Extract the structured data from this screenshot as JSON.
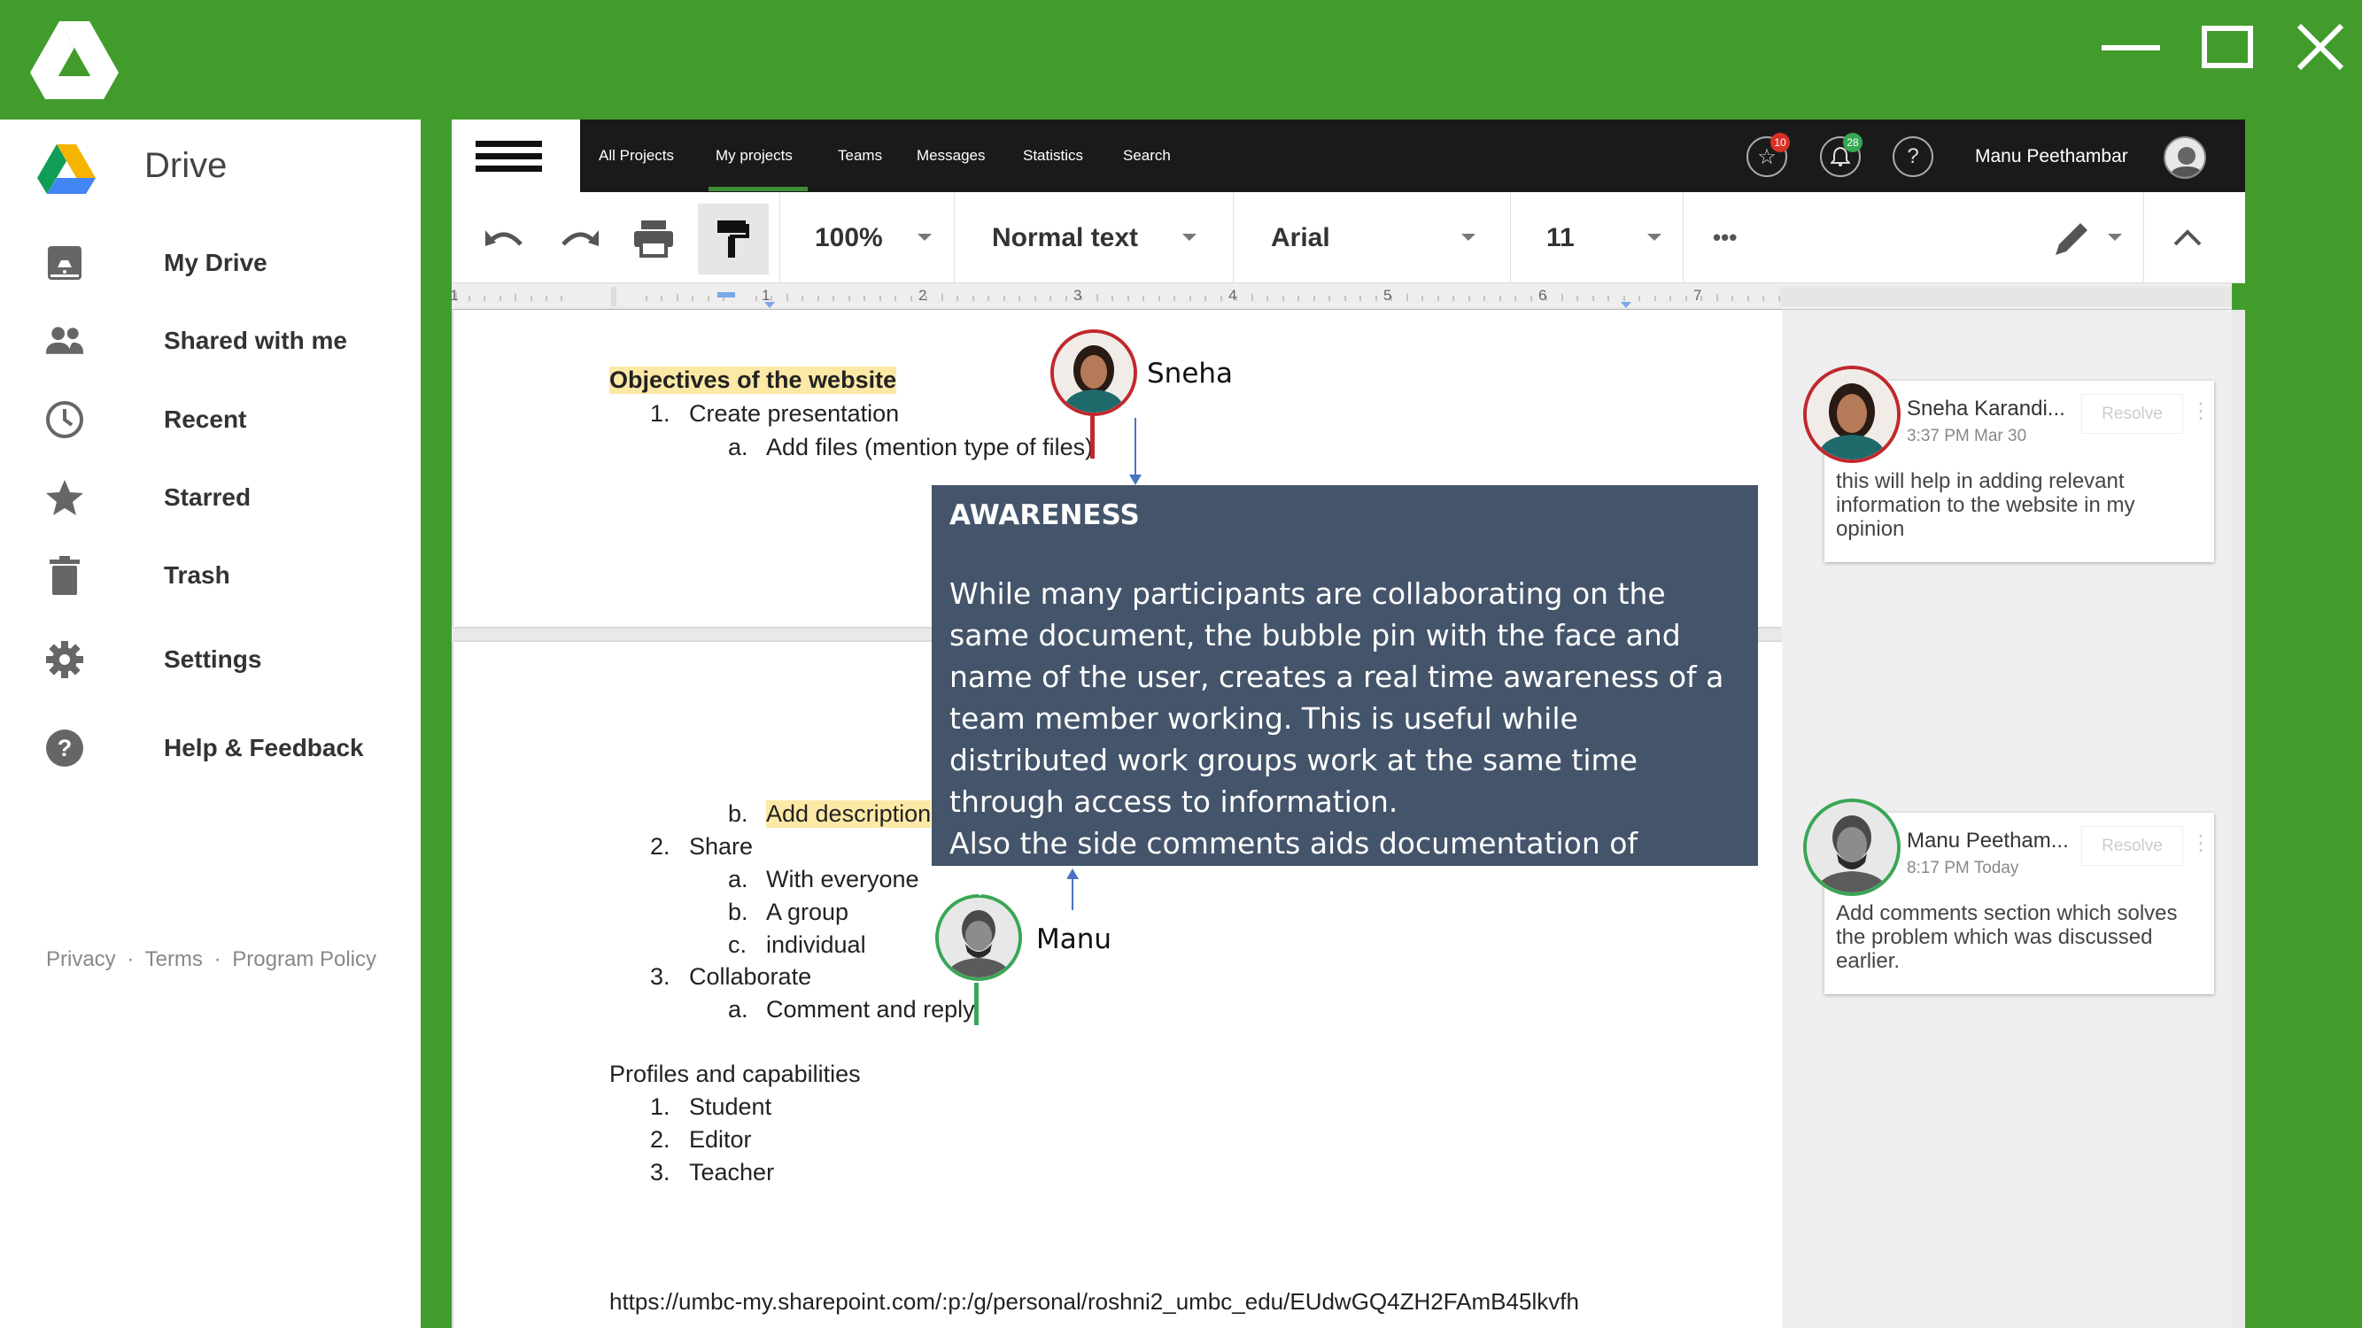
{
  "window": {
    "logo_icon": "google-drive-logo-white",
    "minimize_icon": "minimize-icon",
    "maximize_icon": "maximize-icon",
    "close_icon": "close-icon"
  },
  "drive": {
    "title": "Drive",
    "items": [
      {
        "label": "My Drive",
        "icon": "drive-folder-icon"
      },
      {
        "label": "Shared with me",
        "icon": "people-icon"
      },
      {
        "label": "Recent",
        "icon": "clock-icon"
      },
      {
        "label": "Starred",
        "icon": "star-icon"
      },
      {
        "label": "Trash",
        "icon": "trash-icon"
      },
      {
        "label": "Settings",
        "icon": "gear-icon"
      },
      {
        "label": "Help & Feedback",
        "icon": "help-icon"
      }
    ],
    "footer": {
      "privacy": "Privacy",
      "sep": "·",
      "terms": "Terms",
      "policy": "Program Policy"
    }
  },
  "appbar": {
    "nav": [
      "All Projects",
      "My projects",
      "Teams",
      "Messages",
      "Statistics",
      "Search"
    ],
    "active_tab": "My projects",
    "star_badge": "10",
    "bell_badge": "28",
    "help": "?",
    "user_name": "Manu Peethambar"
  },
  "toolbar": {
    "zoom": "100%",
    "style": "Normal text",
    "font": "Arial",
    "size": "11",
    "more": "•••"
  },
  "ruler": {
    "marks": [
      "1",
      "1",
      "2",
      "3",
      "4",
      "5",
      "6",
      "7"
    ]
  },
  "document": {
    "page1": {
      "heading": "Objectives of the website",
      "l1": "1.",
      "t1": "Create presentation",
      "l1a": "a.",
      "t1a": "Add files (mention type of files)"
    },
    "page2": {
      "l1b": "b.",
      "t1b": "Add description",
      "l2": "2.",
      "t2": "Share",
      "l2a": "a.",
      "t2a": "With everyone",
      "l2b": "b.",
      "t2b": "A group",
      "l2c": "c.",
      "t2c": "individual",
      "l3": "3.",
      "t3": "Collaborate",
      "l3a": "a.",
      "t3a": "Comment and reply",
      "profiles": "Profiles and capabilities",
      "p1n": "1.",
      "p1": "Student",
      "p2n": "2.",
      "p2": "Editor",
      "p3n": "3.",
      "p3": "Teacher",
      "link": "https://umbc-my.sharepoint.com/:p:/g/personal/roshni2_umbc_edu/EUdwGQ4ZH2FAmB45lkvfh"
    }
  },
  "bubbles": {
    "sneha": "Sneha",
    "manu": "Manu"
  },
  "callout": {
    "title": "AWARENESS",
    "body1": "While many participants are collaborating on the same document, the bubble pin with the face and name of the user, creates a real time awareness of a team member working. This is useful while distributed work groups work at the same time through access to information.",
    "body2": "Also the side comments aids documentation of changes."
  },
  "comments": [
    {
      "name": "Sneha Karandi...",
      "time": "3:37 PM Mar 30",
      "resolve": "Resolve",
      "text": "this will help in adding relevant information to the website in my opinion",
      "ring": "#c0282d"
    },
    {
      "name": "Manu Peetham...",
      "time": "8:17 PM Today",
      "resolve": "Resolve",
      "text": "Add comments section which solves the problem which was discussed earlier.",
      "ring": "#3aa655"
    }
  ],
  "colors": {
    "titlebar": "#429C2C",
    "appbar": "#1a1a1a",
    "callout": "#44546a",
    "highlight": "#fde9a6",
    "sneha_pin": "#c0282d",
    "manu_pin": "#3aa655"
  }
}
